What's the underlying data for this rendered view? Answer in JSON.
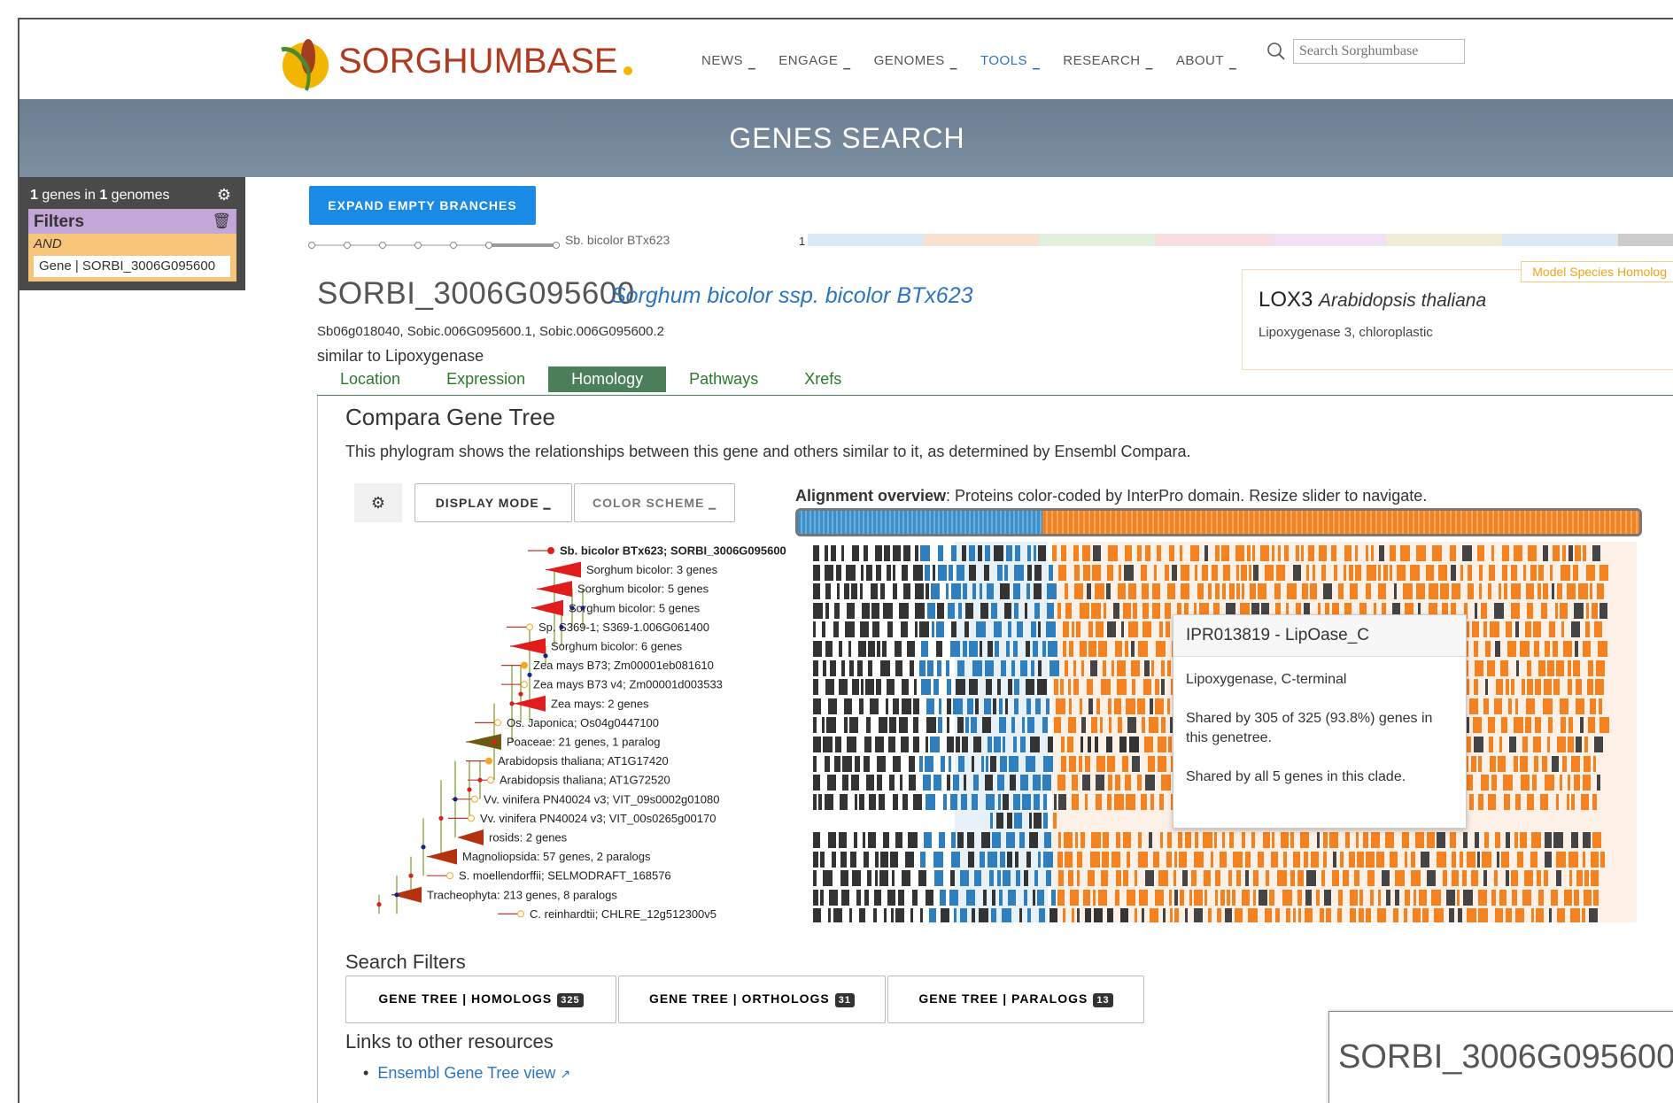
{
  "header": {
    "logo_text": "SORGHUMBASE",
    "nav": [
      {
        "label": "NEWS"
      },
      {
        "label": "ENGAGE"
      },
      {
        "label": "GENOMES"
      },
      {
        "label": "TOOLS"
      },
      {
        "label": "RESEARCH"
      },
      {
        "label": "ABOUT"
      }
    ],
    "search_placeholder": "Search Sorghumbase"
  },
  "banner": {
    "title": "GENES SEARCH"
  },
  "sidebar": {
    "count_genes": "1",
    "count_genes_label": "genes in",
    "count_genomes": "1",
    "count_genomes_label": "genomes",
    "filters_label": "Filters",
    "and_label": "AND",
    "gene_filter": "Gene | SORBI_3006G095600"
  },
  "main": {
    "expand_button": "EXPAND EMPTY BRANCHES",
    "slider_label": "Sb. bicolor BTx623",
    "strip_start": "1",
    "gene_id": "SORBI_3006G095600",
    "species": "Sorghum bicolor ssp. bicolor BTx623",
    "synonyms": "Sb06g018040, Sobic.006G095600.1, Sobic.006G095600.2",
    "description": "similar to Lipoxygenase",
    "homolog": {
      "badge": "Model Species Homolog",
      "name": "LOX3",
      "species": "Arabidopsis thaliana",
      "desc": "Lipoxygenase 3, chloroplastic"
    },
    "tabs": [
      {
        "label": "Location"
      },
      {
        "label": "Expression"
      },
      {
        "label": "Homology"
      },
      {
        "label": "Pathways"
      },
      {
        "label": "Xrefs"
      }
    ],
    "active_tab": "Homology",
    "compara_title": "Compara Gene Tree",
    "compara_desc": "This phylogram shows the relationships between this gene and others similar to it, as determined by Ensembl Compara.",
    "display_mode": "DISPLAY MODE",
    "color_scheme": "COLOR SCHEME",
    "align_bold": "Alignment overview",
    "align_rest": ": Proteins color-coded by InterPro domain. Resize slider to navigate.",
    "tree_leaves": [
      "Sb. bicolor BTx623; SORBI_3006G095600",
      "Sorghum bicolor: 3 genes",
      "Sorghum bicolor: 5 genes",
      "Sorghum bicolor: 5 genes",
      "Sp. S369-1; S369-1.006G061400",
      "Sorghum bicolor: 6 genes",
      "Zea mays B73; Zm00001eb081610",
      "Zea mays B73 v4; Zm00001d003533",
      "Zea mays: 2 genes",
      "Os. Japonica; Os04g0447100",
      "Poaceae: 21 genes, 1 paralog",
      "Arabidopsis thaliana; AT1G17420",
      "Arabidopsis thaliana; AT1G72520",
      "Vv. vinifera PN40024 v3; VIT_09s0002g01080",
      "Vv. vinifera PN40024 v3; VIT_00s0265g00170",
      "rosids: 2 genes",
      "Magnoliopsida: 57 genes, 2 paralogs",
      "S. moellendorffii; SELMODRAFT_168576",
      "Tracheophyta: 213 genes, 8 paralogs",
      "C. reinhardtii; CHLRE_12g512300v5"
    ],
    "tooltip": {
      "title": "IPR013819 - LipOase_C",
      "line1": "Lipoxygenase, C-terminal",
      "line2": "Shared by 305 of 325 (93.8%) genes in this genetree.",
      "line3": "Shared by all 5 genes in this clade."
    },
    "search_filters_title": "Search Filters",
    "search_filters": [
      {
        "label": "GENE TREE | HOMOLOGS",
        "count": "325"
      },
      {
        "label": "GENE TREE | ORTHOLOGS",
        "count": "31"
      },
      {
        "label": "GENE TREE | PARALOGS",
        "count": "13"
      }
    ],
    "links_title": "Links to other resources",
    "link_ensembl": "Ensembl Gene Tree view",
    "corner_title": "SORBI_3006G095600"
  },
  "colors": {
    "accent_blue": "#1a8ae6",
    "tab_green": "#4a7f59",
    "domain_orange": "#f58220",
    "domain_blue": "#2f7fbf"
  }
}
